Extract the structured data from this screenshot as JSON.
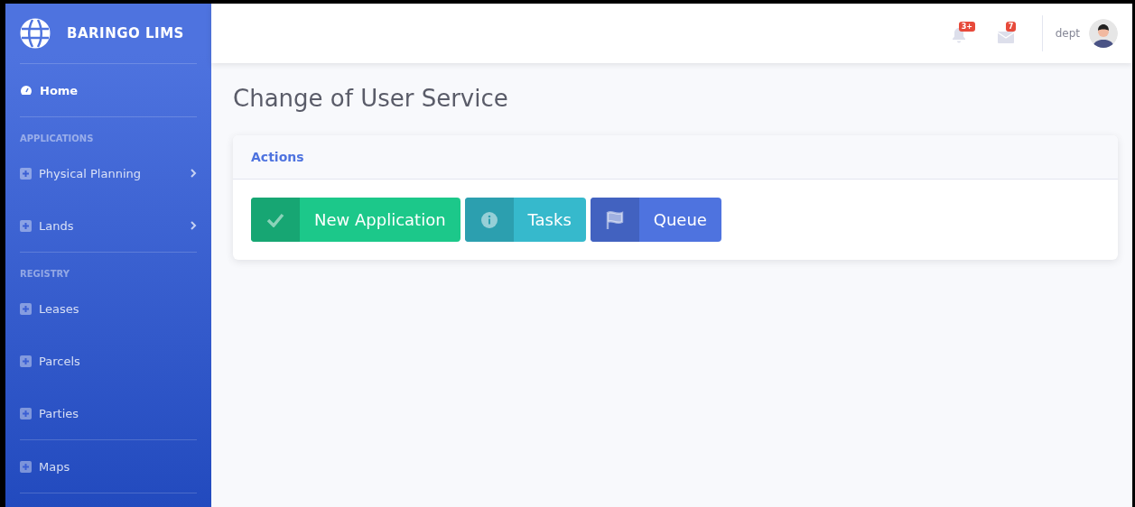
{
  "sidebar": {
    "brand": "BARINGO LIMS",
    "items": [
      {
        "kind": "dashboard",
        "label": "Home",
        "active": true
      },
      {
        "kind": "divider"
      },
      {
        "kind": "heading",
        "label": "APPLICATIONS"
      },
      {
        "kind": "link",
        "label": "Physical Planning",
        "active": false,
        "has_submenu": true
      },
      {
        "kind": "link",
        "label": "Lands",
        "active": false,
        "has_submenu": true
      },
      {
        "kind": "divider"
      },
      {
        "kind": "heading",
        "label": "REGISTRY"
      },
      {
        "kind": "link",
        "label": "Leases",
        "active": false,
        "has_submenu": false
      },
      {
        "kind": "link",
        "label": "Parcels",
        "active": false,
        "has_submenu": false
      },
      {
        "kind": "link",
        "label": "Parties",
        "active": false,
        "has_submenu": false
      },
      {
        "kind": "divider"
      },
      {
        "kind": "link",
        "label": "Maps",
        "active": false,
        "has_submenu": false
      },
      {
        "kind": "divider"
      }
    ]
  },
  "topbar": {
    "alerts_badge": "3+",
    "messages_badge": "7",
    "user": "dept"
  },
  "page": {
    "title": "Change of User Service",
    "card": {
      "header": "Actions",
      "buttons": [
        {
          "kind": "success",
          "label": "New Application"
        },
        {
          "kind": "info",
          "label": "Tasks"
        },
        {
          "kind": "primary",
          "label": "Queue"
        }
      ]
    }
  }
}
